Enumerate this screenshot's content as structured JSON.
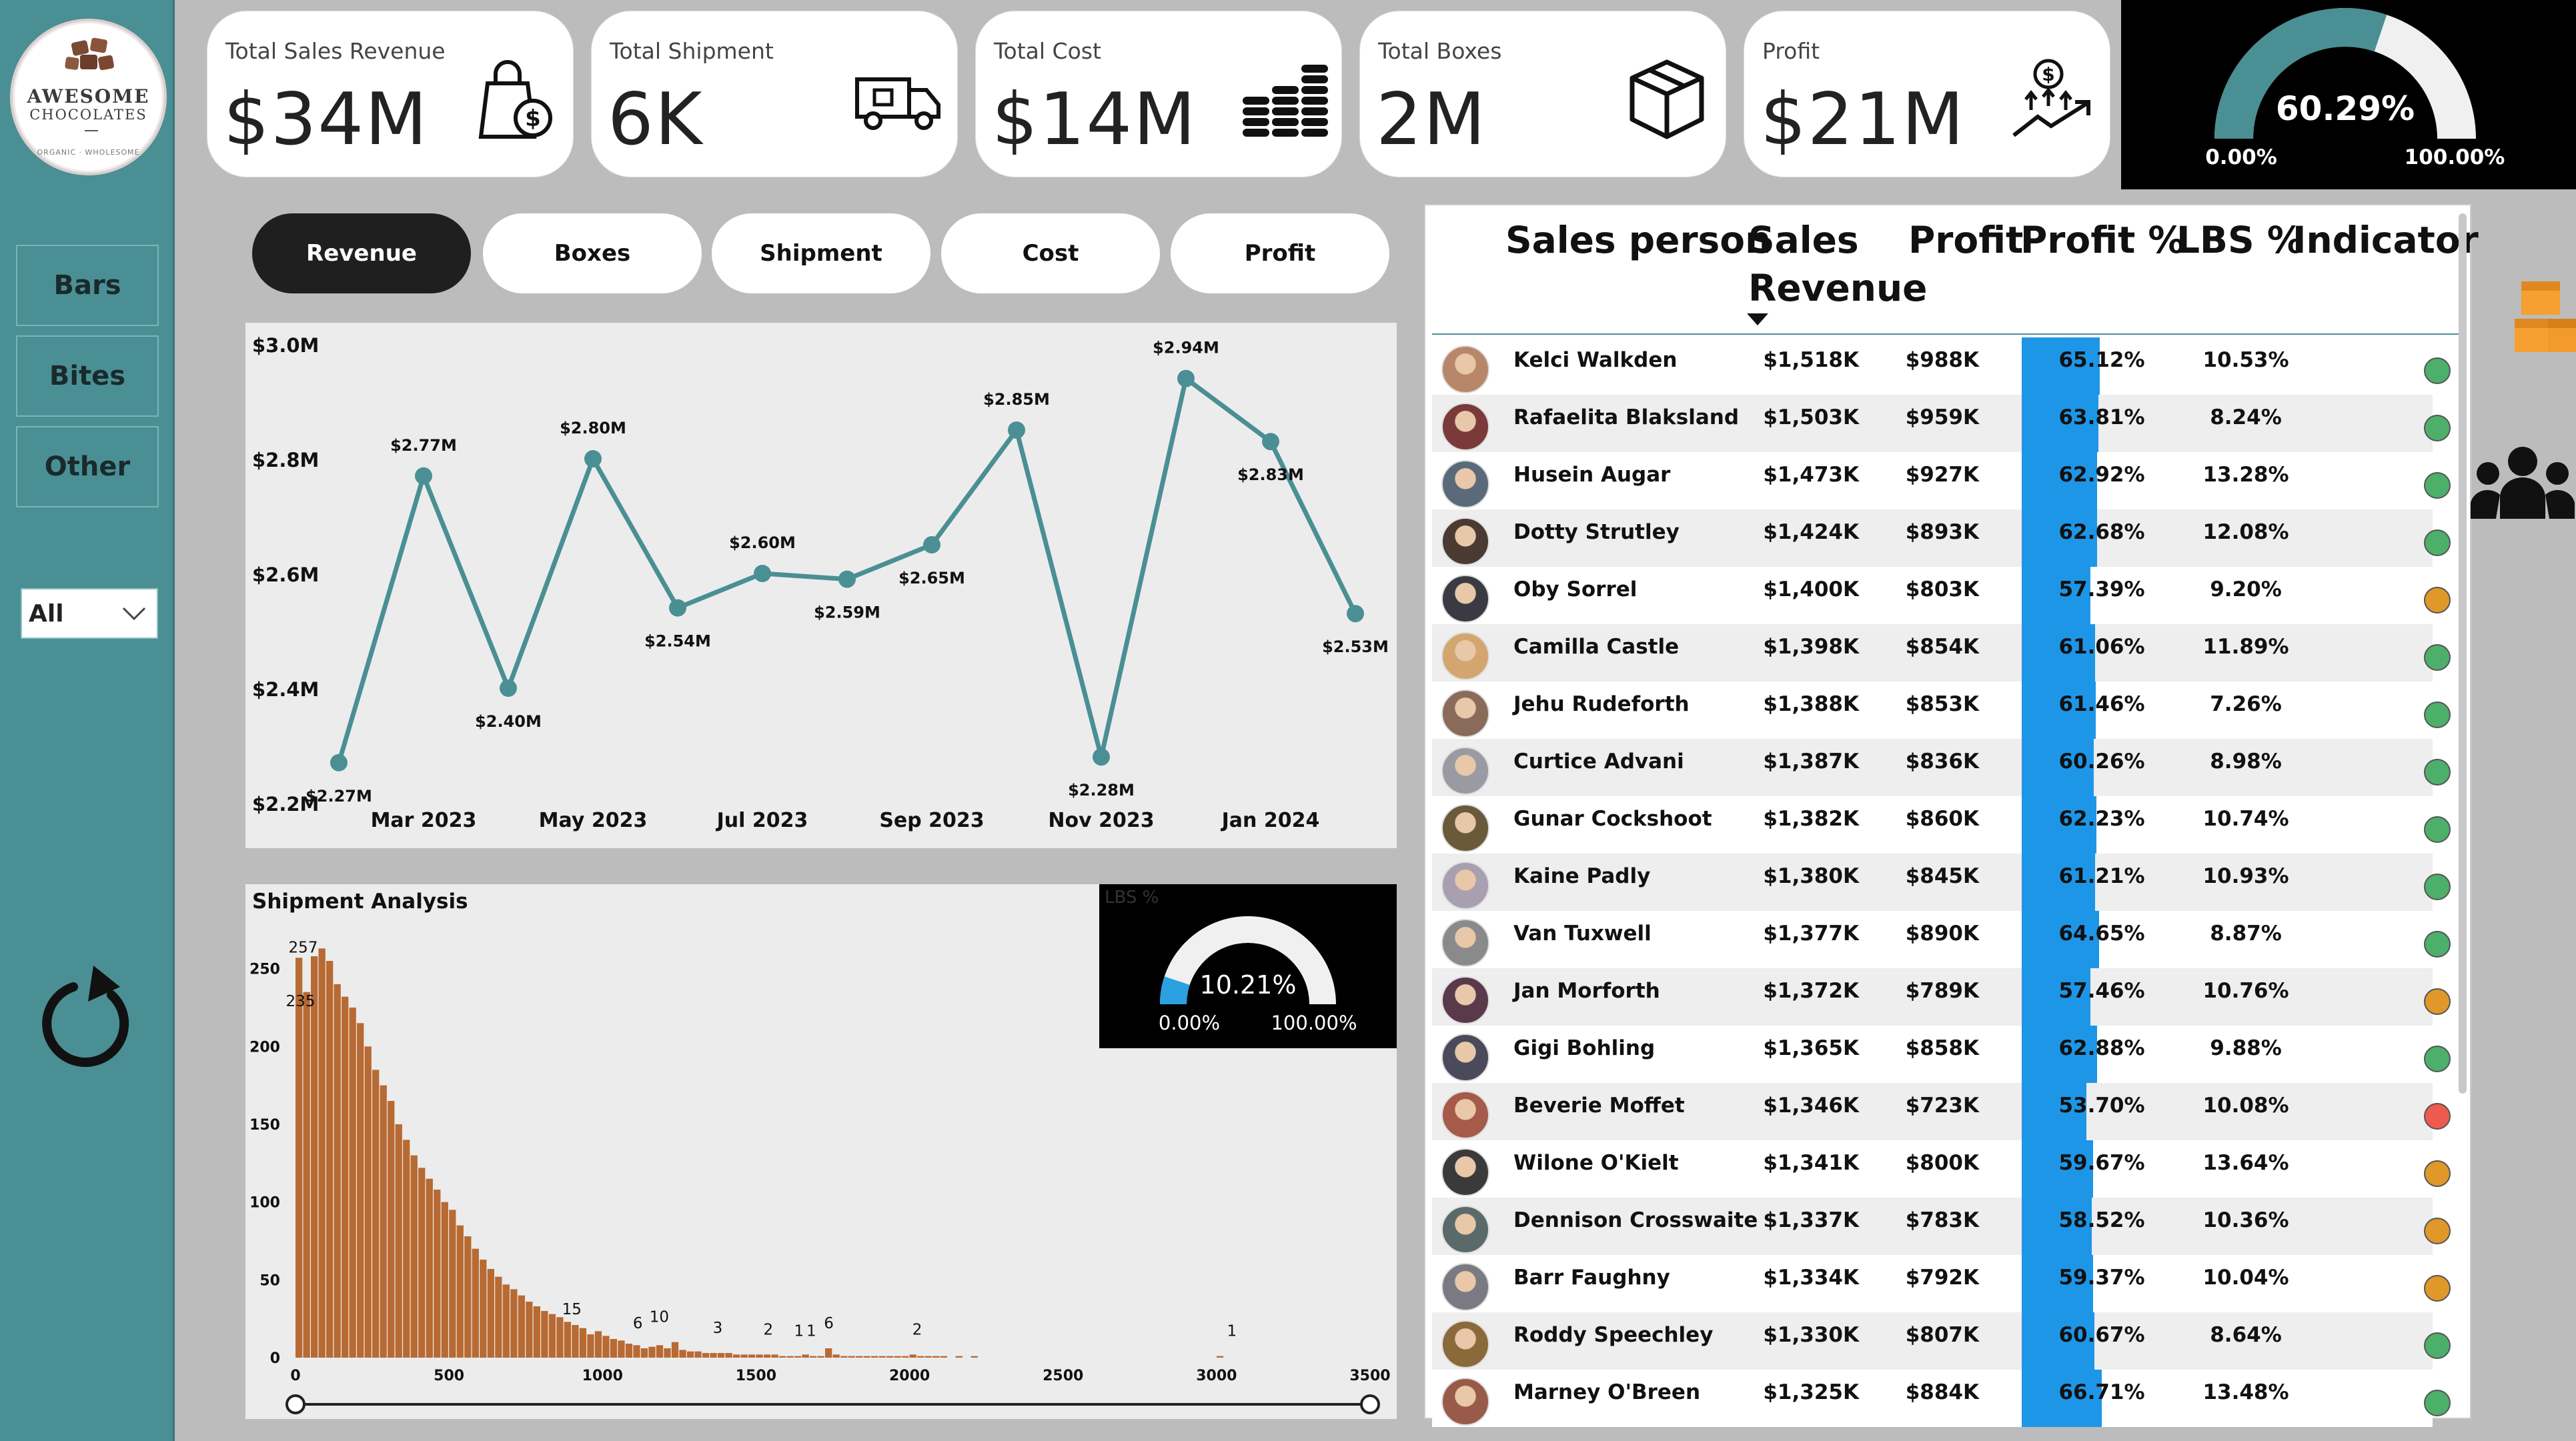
{
  "brand": {
    "line1": "AWESOME",
    "line2": "CHOCOLATES",
    "line3": "ORGANIC · WHOLESOME"
  },
  "sidebar": {
    "items": [
      {
        "label": "Bars"
      },
      {
        "label": "Bites"
      },
      {
        "label": "Other"
      }
    ],
    "dropdown_value": "All"
  },
  "kpis": [
    {
      "label": "Total Sales Revenue",
      "value": "$34M",
      "icon": "shopping-bag-dollar-icon"
    },
    {
      "label": "Total Shipment",
      "value": "6K",
      "icon": "delivery-truck-icon"
    },
    {
      "label": "Total Cost",
      "value": "$14M",
      "icon": "coin-stacks-icon"
    },
    {
      "label": "Total Boxes",
      "value": "2M",
      "icon": "box-icon"
    },
    {
      "label": "Profit",
      "value": "$21M",
      "icon": "profit-growth-icon"
    }
  ],
  "profit_gauge": {
    "value": "60.29%",
    "fraction": 0.6029,
    "min": "0.00%",
    "max": "100.00%",
    "fill_color": "#4a8f94"
  },
  "tabs": [
    {
      "label": "Revenue",
      "active": true
    },
    {
      "label": "Boxes",
      "active": false
    },
    {
      "label": "Shipment",
      "active": false
    },
    {
      "label": "Cost",
      "active": false
    },
    {
      "label": "Profit",
      "active": false
    }
  ],
  "chart_data": [
    {
      "type": "line",
      "color": "#4a8f94",
      "yticks": [
        "$3.0M",
        "$2.8M",
        "$2.6M",
        "$2.4M",
        "$2.2M"
      ],
      "ylim": [
        2.2,
        3.0
      ],
      "xticks": [
        "Mar 2023",
        "May 2023",
        "Jul 2023",
        "Sep 2023",
        "Nov 2023",
        "Jan 2024"
      ],
      "x": [
        "Feb 2023",
        "Mar 2023",
        "Apr 2023",
        "May 2023",
        "Jun 2023",
        "Jul 2023",
        "Aug 2023",
        "Sep 2023",
        "Oct 2023",
        "Nov 2023",
        "Dec 2023",
        "Jan 2024",
        "Feb 2024"
      ],
      "values": [
        2.27,
        2.77,
        2.4,
        2.8,
        2.54,
        2.6,
        2.59,
        2.65,
        2.85,
        2.28,
        2.94,
        2.83,
        2.53
      ],
      "labels": [
        "$2.27M",
        "$2.77M",
        "$2.40M",
        "$2.80M",
        "$2.54M",
        "$2.60M",
        "$2.59M",
        "$2.65M",
        "$2.85M",
        "$2.28M",
        "$2.94M",
        "$2.83M",
        "$2.53M"
      ]
    },
    {
      "type": "bar",
      "title": "Shipment Analysis",
      "color": "#b86a33",
      "xlim": [
        0,
        3500
      ],
      "ylim": [
        0,
        270
      ],
      "xticks": [
        "0",
        "500",
        "1000",
        "1500",
        "2000",
        "2500",
        "3000",
        "3500"
      ],
      "yticks": [
        "250",
        "200",
        "150",
        "100",
        "50",
        "0"
      ],
      "bin_width": 25,
      "values": [
        257,
        235,
        258,
        263,
        255,
        240,
        232,
        225,
        215,
        200,
        185,
        175,
        165,
        150,
        140,
        130,
        122,
        115,
        108,
        100,
        95,
        85,
        78,
        70,
        63,
        57,
        52,
        47,
        44,
        40,
        36,
        33,
        30,
        28,
        26,
        23,
        21,
        19,
        15,
        17,
        14,
        12,
        11,
        9,
        8,
        6,
        7,
        8,
        6,
        10,
        5,
        4,
        4,
        3,
        3,
        3,
        3,
        2,
        2,
        2,
        2,
        2,
        2,
        1,
        1,
        1,
        2,
        1,
        1,
        6,
        2,
        1,
        1,
        1,
        1,
        1,
        1,
        1,
        1,
        1,
        2,
        1,
        1,
        1,
        1,
        0,
        1,
        0,
        1,
        0,
        0,
        0,
        0,
        0,
        0,
        0,
        0,
        0,
        0,
        0,
        0,
        0,
        0,
        0,
        0,
        0,
        0,
        0,
        0,
        0,
        0,
        0,
        0,
        0,
        0,
        0,
        0,
        0,
        0,
        0,
        1
      ],
      "annotations": [
        {
          "x": 25,
          "label": "257"
        },
        {
          "x": 25,
          "label": "235"
        },
        {
          "x": 900,
          "label": "15"
        },
        {
          "x": 1115,
          "label": "6"
        },
        {
          "x": 1185,
          "label": "10"
        },
        {
          "x": 1375,
          "label": "3"
        },
        {
          "x": 1540,
          "label": "2"
        },
        {
          "x": 1640,
          "label": "1"
        },
        {
          "x": 1680,
          "label": "1"
        },
        {
          "x": 1737,
          "label": "6"
        },
        {
          "x": 2025,
          "label": "2"
        },
        {
          "x": 3050,
          "label": "1"
        }
      ]
    }
  ],
  "lbs_gauge": {
    "title": "LBS %",
    "value": "10.21%",
    "fraction": 0.1021,
    "min": "0.00%",
    "max": "100.00%",
    "fill_color": "#2aa0e0"
  },
  "table": {
    "headers": {
      "person": "Sales person",
      "revenue1": "Sales",
      "revenue2": "Revenue",
      "profit": "Profit",
      "profit_pct": "Profit %",
      "lbs": "LBS %",
      "indicator": "Indicator"
    },
    "rows": [
      {
        "name": "Kelci Walkden",
        "revenue": "$1,518K",
        "profit": "$988K",
        "pct": "65.12%",
        "pct_value": 0.6512,
        "lbs": "10.53%",
        "indicator": "green",
        "avatar": "#b8876a"
      },
      {
        "name": "Rafaelita Blaksland",
        "revenue": "$1,503K",
        "profit": "$959K",
        "pct": "63.81%",
        "pct_value": 0.6381,
        "lbs": "8.24%",
        "indicator": "green",
        "avatar": "#7a3a3a"
      },
      {
        "name": "Husein Augar",
        "revenue": "$1,473K",
        "profit": "$927K",
        "pct": "62.92%",
        "pct_value": 0.6292,
        "lbs": "13.28%",
        "indicator": "green",
        "avatar": "#5a6a7a"
      },
      {
        "name": "Dotty Strutley",
        "revenue": "$1,424K",
        "profit": "$893K",
        "pct": "62.68%",
        "pct_value": 0.6268,
        "lbs": "12.08%",
        "indicator": "green",
        "avatar": "#4a3a32"
      },
      {
        "name": "Oby Sorrel",
        "revenue": "$1,400K",
        "profit": "$803K",
        "pct": "57.39%",
        "pct_value": 0.5739,
        "lbs": "9.20%",
        "indicator": "orange",
        "avatar": "#3a3a42"
      },
      {
        "name": "Camilla Castle",
        "revenue": "$1,398K",
        "profit": "$854K",
        "pct": "61.06%",
        "pct_value": 0.6106,
        "lbs": "11.89%",
        "indicator": "green",
        "avatar": "#d3a670"
      },
      {
        "name": "Jehu Rudeforth",
        "revenue": "$1,388K",
        "profit": "$853K",
        "pct": "61.46%",
        "pct_value": 0.6146,
        "lbs": "7.26%",
        "indicator": "green",
        "avatar": "#8a6a5a"
      },
      {
        "name": "Curtice Advani",
        "revenue": "$1,387K",
        "profit": "$836K",
        "pct": "60.26%",
        "pct_value": 0.6026,
        "lbs": "8.98%",
        "indicator": "green",
        "avatar": "#9a9aa2"
      },
      {
        "name": "Gunar Cockshoot",
        "revenue": "$1,382K",
        "profit": "$860K",
        "pct": "62.23%",
        "pct_value": 0.6223,
        "lbs": "10.74%",
        "indicator": "green",
        "avatar": "#6a5a3a"
      },
      {
        "name": "Kaine Padly",
        "revenue": "$1,380K",
        "profit": "$845K",
        "pct": "61.21%",
        "pct_value": 0.6121,
        "lbs": "10.93%",
        "indicator": "green",
        "avatar": "#a8a0b0"
      },
      {
        "name": "Van Tuxwell",
        "revenue": "$1,377K",
        "profit": "$890K",
        "pct": "64.65%",
        "pct_value": 0.6465,
        "lbs": "8.87%",
        "indicator": "green",
        "avatar": "#8a8a8a"
      },
      {
        "name": "Jan Morforth",
        "revenue": "$1,372K",
        "profit": "$789K",
        "pct": "57.46%",
        "pct_value": 0.5746,
        "lbs": "10.76%",
        "indicator": "orange",
        "avatar": "#5a3a4a"
      },
      {
        "name": "Gigi Bohling",
        "revenue": "$1,365K",
        "profit": "$858K",
        "pct": "62.88%",
        "pct_value": 0.6288,
        "lbs": "9.88%",
        "indicator": "green",
        "avatar": "#4a4a5a"
      },
      {
        "name": "Beverie Moffet",
        "revenue": "$1,346K",
        "profit": "$723K",
        "pct": "53.70%",
        "pct_value": 0.537,
        "lbs": "10.08%",
        "indicator": "red",
        "avatar": "#a65a4a"
      },
      {
        "name": "Wilone O'Kielt",
        "revenue": "$1,341K",
        "profit": "$800K",
        "pct": "59.67%",
        "pct_value": 0.5967,
        "lbs": "13.64%",
        "indicator": "orange",
        "avatar": "#3a3a3a"
      },
      {
        "name": "Dennison Crosswaite",
        "revenue": "$1,337K",
        "profit": "$783K",
        "pct": "58.52%",
        "pct_value": 0.5852,
        "lbs": "10.36%",
        "indicator": "orange",
        "avatar": "#5a6a6a"
      },
      {
        "name": "Barr Faughny",
        "revenue": "$1,334K",
        "profit": "$792K",
        "pct": "59.37%",
        "pct_value": 0.5937,
        "lbs": "10.04%",
        "indicator": "orange",
        "avatar": "#7a7a82"
      },
      {
        "name": "Roddy Speechley",
        "revenue": "$1,330K",
        "profit": "$807K",
        "pct": "60.67%",
        "pct_value": 0.6067,
        "lbs": "8.64%",
        "indicator": "green",
        "avatar": "#8a6a3a"
      },
      {
        "name": "Marney O'Breen",
        "revenue": "$1,325K",
        "profit": "$884K",
        "pct": "66.71%",
        "pct_value": 0.6671,
        "lbs": "13.48%",
        "indicator": "green",
        "avatar": "#9a5a4a"
      }
    ]
  },
  "colors": {
    "green": "#4caf6a",
    "orange": "#e0982a",
    "red": "#ee5a4f",
    "teal": "#4a8f94",
    "bar_blue": "#1e96e8"
  }
}
